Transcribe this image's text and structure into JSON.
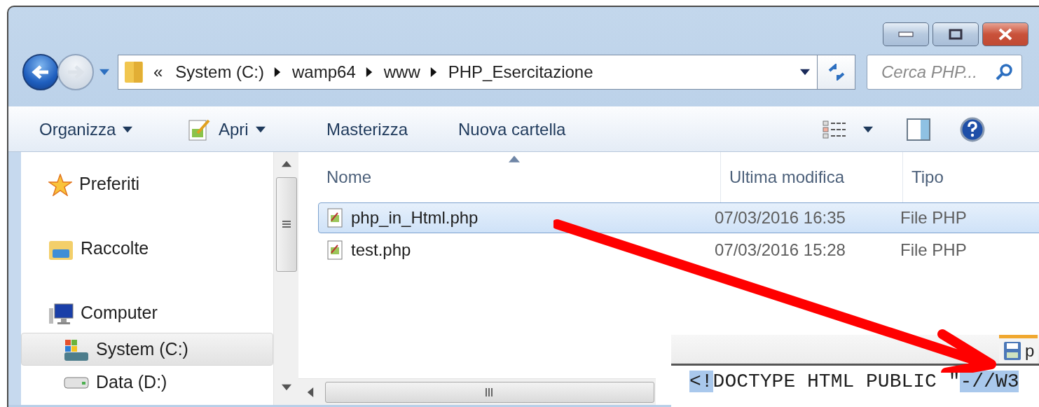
{
  "window": {
    "controls": [
      {
        "kind": "minimize"
      },
      {
        "kind": "maximize"
      },
      {
        "kind": "close"
      }
    ]
  },
  "address_bar": {
    "overflow": "«",
    "crumbs": [
      "System (C:)",
      "wamp64",
      "www",
      "PHP_Esercitazione"
    ]
  },
  "search": {
    "placeholder": "Cerca PHP..."
  },
  "toolbar": {
    "items": [
      {
        "label": "Organizza",
        "kind": "menu"
      },
      {
        "label": "Apri",
        "kind": "open_menu"
      },
      {
        "label": "Masterizza",
        "kind": "plain"
      },
      {
        "label": "Nuova cartella",
        "kind": "plain"
      }
    ]
  },
  "sidebar": {
    "items": [
      {
        "label": "Preferiti",
        "kind": "favorites",
        "selected": false
      },
      {
        "label": "Raccolte",
        "kind": "libraries",
        "selected": false
      },
      {
        "label": "Computer",
        "kind": "computer",
        "selected": false,
        "children": [
          {
            "label": "System (C:)",
            "kind": "system_drive",
            "selected": true
          },
          {
            "label": "Data (D:)",
            "kind": "drive",
            "selected": false
          }
        ]
      }
    ]
  },
  "file_list": {
    "columns": [
      "Nome",
      "Ultima modifica",
      "Tipo"
    ],
    "rows": [
      {
        "name": "php_in_Html.php",
        "modified": "07/03/2016 16:35",
        "type": "File PHP",
        "selected": true
      },
      {
        "name": "test.php",
        "modified": "07/03/2016 15:28",
        "type": "File PHP",
        "selected": false
      }
    ]
  },
  "editor": {
    "tab_label": "p",
    "code_line": [
      {
        "text": "<!",
        "highlighted": true
      },
      {
        "text": "DOCTYPE HTML PUBLIC \"",
        "highlighted": false
      },
      {
        "text": "-//W3",
        "highlighted": true
      }
    ]
  }
}
